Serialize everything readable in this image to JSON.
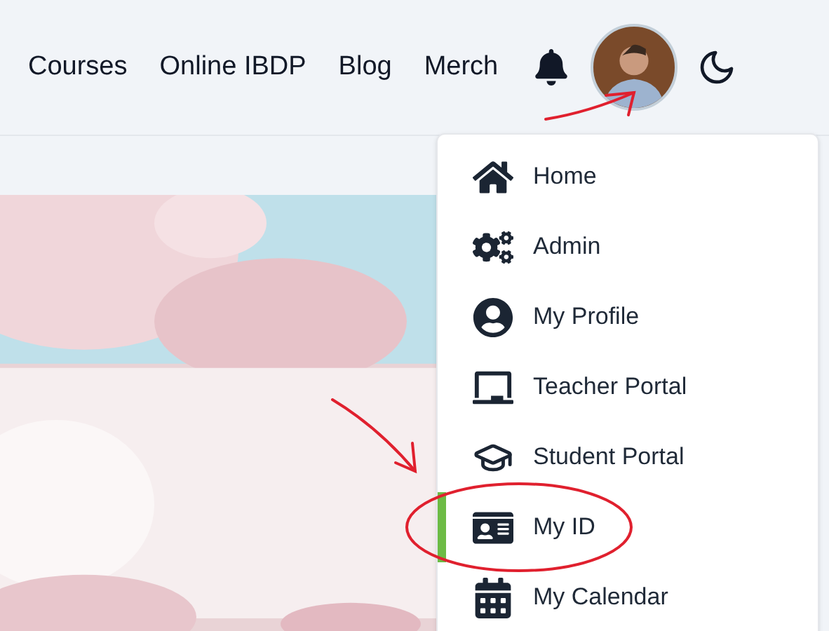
{
  "nav": [
    {
      "label": "Courses"
    },
    {
      "label": "Online IBDP"
    },
    {
      "label": "Blog"
    },
    {
      "label": "Merch"
    }
  ],
  "menu": {
    "items": [
      {
        "label": "Home",
        "kind": "home",
        "selected": false
      },
      {
        "label": "Admin",
        "kind": "cogs",
        "selected": false
      },
      {
        "label": "My Profile",
        "kind": "profile",
        "selected": false
      },
      {
        "label": "Teacher Portal",
        "kind": "board",
        "selected": false
      },
      {
        "label": "Student Portal",
        "kind": "cap",
        "selected": false
      },
      {
        "label": "My ID",
        "kind": "id",
        "selected": true
      },
      {
        "label": "My Calendar",
        "kind": "calendar",
        "selected": false
      }
    ]
  }
}
